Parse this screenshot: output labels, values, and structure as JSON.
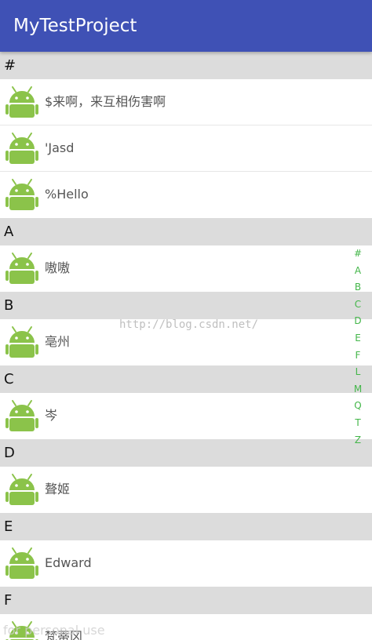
{
  "app_bar": {
    "title": "MyTestProject",
    "color": "#3F51B5"
  },
  "sections": [
    {
      "header": "#",
      "contacts": [
        "$来啊，来互相伤害啊",
        "'Jasd",
        "%Hello"
      ]
    },
    {
      "header": "A",
      "contacts": [
        "嗷嗷"
      ]
    },
    {
      "header": "B",
      "contacts": [
        "亳州"
      ]
    },
    {
      "header": "C",
      "contacts": [
        "岑"
      ]
    },
    {
      "header": "D",
      "contacts": [
        "聱姬"
      ]
    },
    {
      "header": "E",
      "contacts": [
        "Edward"
      ]
    },
    {
      "header": "F",
      "contacts": [
        "梵蒂冈"
      ]
    }
  ],
  "avatar_icon": "android-icon",
  "index_bar": {
    "letters": [
      "#",
      "A",
      "B",
      "C",
      "D",
      "E",
      "F",
      "L",
      "M",
      "Q",
      "T",
      "Z"
    ],
    "color": "#43b649"
  },
  "watermark": {
    "text": "http://blog.csdn.net/",
    "footer": "for personal use"
  }
}
